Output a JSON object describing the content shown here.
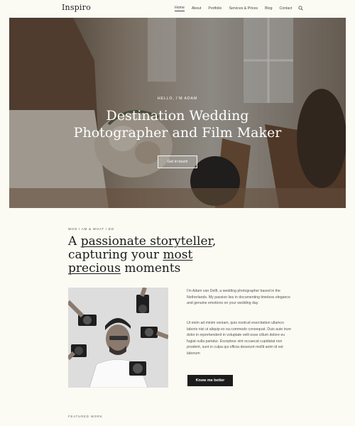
{
  "header": {
    "logo": "Inspiro",
    "nav": [
      "Home",
      "About",
      "Portfolio",
      "Services & Prices",
      "Blog",
      "Contact"
    ],
    "search_icon": "search-icon"
  },
  "hero": {
    "kicker": "HELLO, I'M ADAM",
    "title_line1": "Destination Wedding",
    "title_line2": "Photographer and Film Maker",
    "button": "Get in touch"
  },
  "about": {
    "kicker": "WHO I AM & WHAT I DO",
    "title": {
      "a": "A ",
      "b": "passionate storyteller",
      "c": ",",
      "d": "capturing your ",
      "e": "most",
      "f": "precious",
      "g": " moments"
    },
    "para1": "I'm Adam van Delft, a wedding photographer based in the Netherlands. My passion lies in documenting timeless elegance and genuine emotions on your wedding day.",
    "para2": "Ut enim ad minim veniam, quis nostrud exercitation ullamco laboris nisi ut aliquip ex ea commodo consequat. Duis aute irure dolor in reprehenderit in voluptate velit esse cillum dolore eu fugiat nulla pariatur. Excepteur sint occaecat cupidatat non proident, sunt in culpa qui officia deserunt mollit anim id est laborum",
    "button": "Know me better"
  },
  "featured": {
    "kicker": "FEATURED WORK"
  },
  "colors": {
    "background": "#fbfbf4",
    "text": "#1a1a1a",
    "button_dark": "#1c1c1c"
  }
}
